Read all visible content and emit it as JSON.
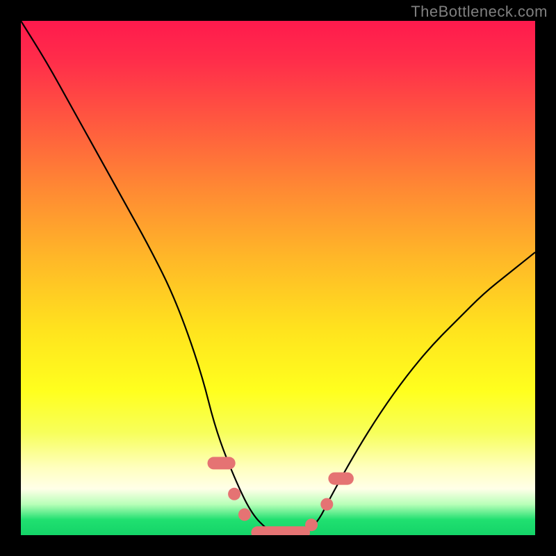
{
  "watermark": "TheBottleneck.com",
  "colors": {
    "background": "#000000",
    "curve": "#000000",
    "marker": "#e57373"
  },
  "chart_data": {
    "type": "line",
    "title": "",
    "xlabel": "",
    "ylabel": "",
    "xlim": [
      0,
      100
    ],
    "ylim": [
      0,
      100
    ],
    "grid": false,
    "series": [
      {
        "name": "bottleneck-curve",
        "x": [
          0,
          5,
          10,
          15,
          20,
          25,
          30,
          35,
          38,
          42,
          45,
          48,
          50,
          53,
          56,
          58,
          60,
          65,
          70,
          75,
          80,
          85,
          90,
          95,
          100
        ],
        "y": [
          100,
          92,
          83,
          74,
          65,
          56,
          46,
          32,
          20,
          10,
          4,
          1,
          0,
          0,
          1,
          3,
          7,
          16,
          24,
          31,
          37,
          42,
          47,
          51,
          55
        ]
      }
    ],
    "markers": [
      {
        "shape": "pill",
        "x0": 37.5,
        "x1": 40.5,
        "y": 14
      },
      {
        "shape": "round",
        "x": 41.5,
        "y": 8
      },
      {
        "shape": "round",
        "x": 43.5,
        "y": 4
      },
      {
        "shape": "pill",
        "x0": 46.0,
        "x1": 55.0,
        "y": 0.5
      },
      {
        "shape": "round",
        "x": 56.5,
        "y": 2
      },
      {
        "shape": "round",
        "x": 59.5,
        "y": 6
      },
      {
        "shape": "pill",
        "x0": 61.0,
        "x1": 63.5,
        "y": 11
      }
    ],
    "gradient_stops": [
      {
        "pos": 0.0,
        "color": "#ff1a4d"
      },
      {
        "pos": 0.33,
        "color": "#ff8a33"
      },
      {
        "pos": 0.6,
        "color": "#ffe31e"
      },
      {
        "pos": 0.87,
        "color": "#ffffc0"
      },
      {
        "pos": 0.97,
        "color": "#20e070"
      },
      {
        "pos": 1.0,
        "color": "#14d468"
      }
    ]
  }
}
